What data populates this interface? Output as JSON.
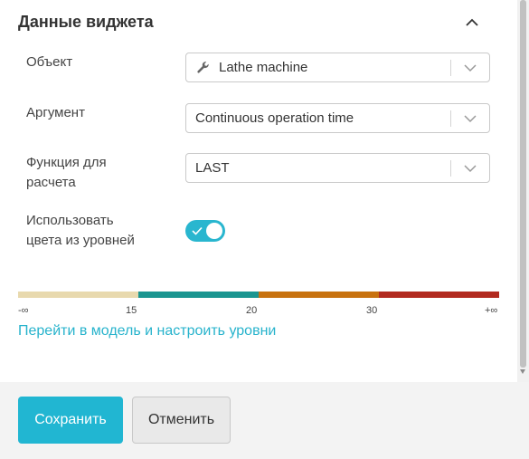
{
  "header": {
    "title": "Данные виджета"
  },
  "fields": {
    "object": {
      "label": "Объект",
      "value": "Lathe machine",
      "icon": "wrench-icon"
    },
    "argument": {
      "label": "Аргумент",
      "value": "Continuous operation time"
    },
    "function": {
      "label_line1": "Функция для",
      "label_line2": "расчета",
      "value": "LAST"
    },
    "use_colors": {
      "label_line1": "Использовать",
      "label_line2": "цвета из уровней",
      "enabled": true
    }
  },
  "levels": {
    "ticks": [
      "-∞",
      "15",
      "20",
      "30",
      "+∞"
    ],
    "colors": [
      "#e8d9ae",
      "#1b9590",
      "#c8720f",
      "#b22a1f"
    ]
  },
  "link": {
    "label": "Перейти в модель и настроить уровни"
  },
  "footer": {
    "save_label": "Сохранить",
    "cancel_label": "Отменить"
  },
  "colors": {
    "accent": "#21b6d2",
    "link": "#27b3cc"
  }
}
